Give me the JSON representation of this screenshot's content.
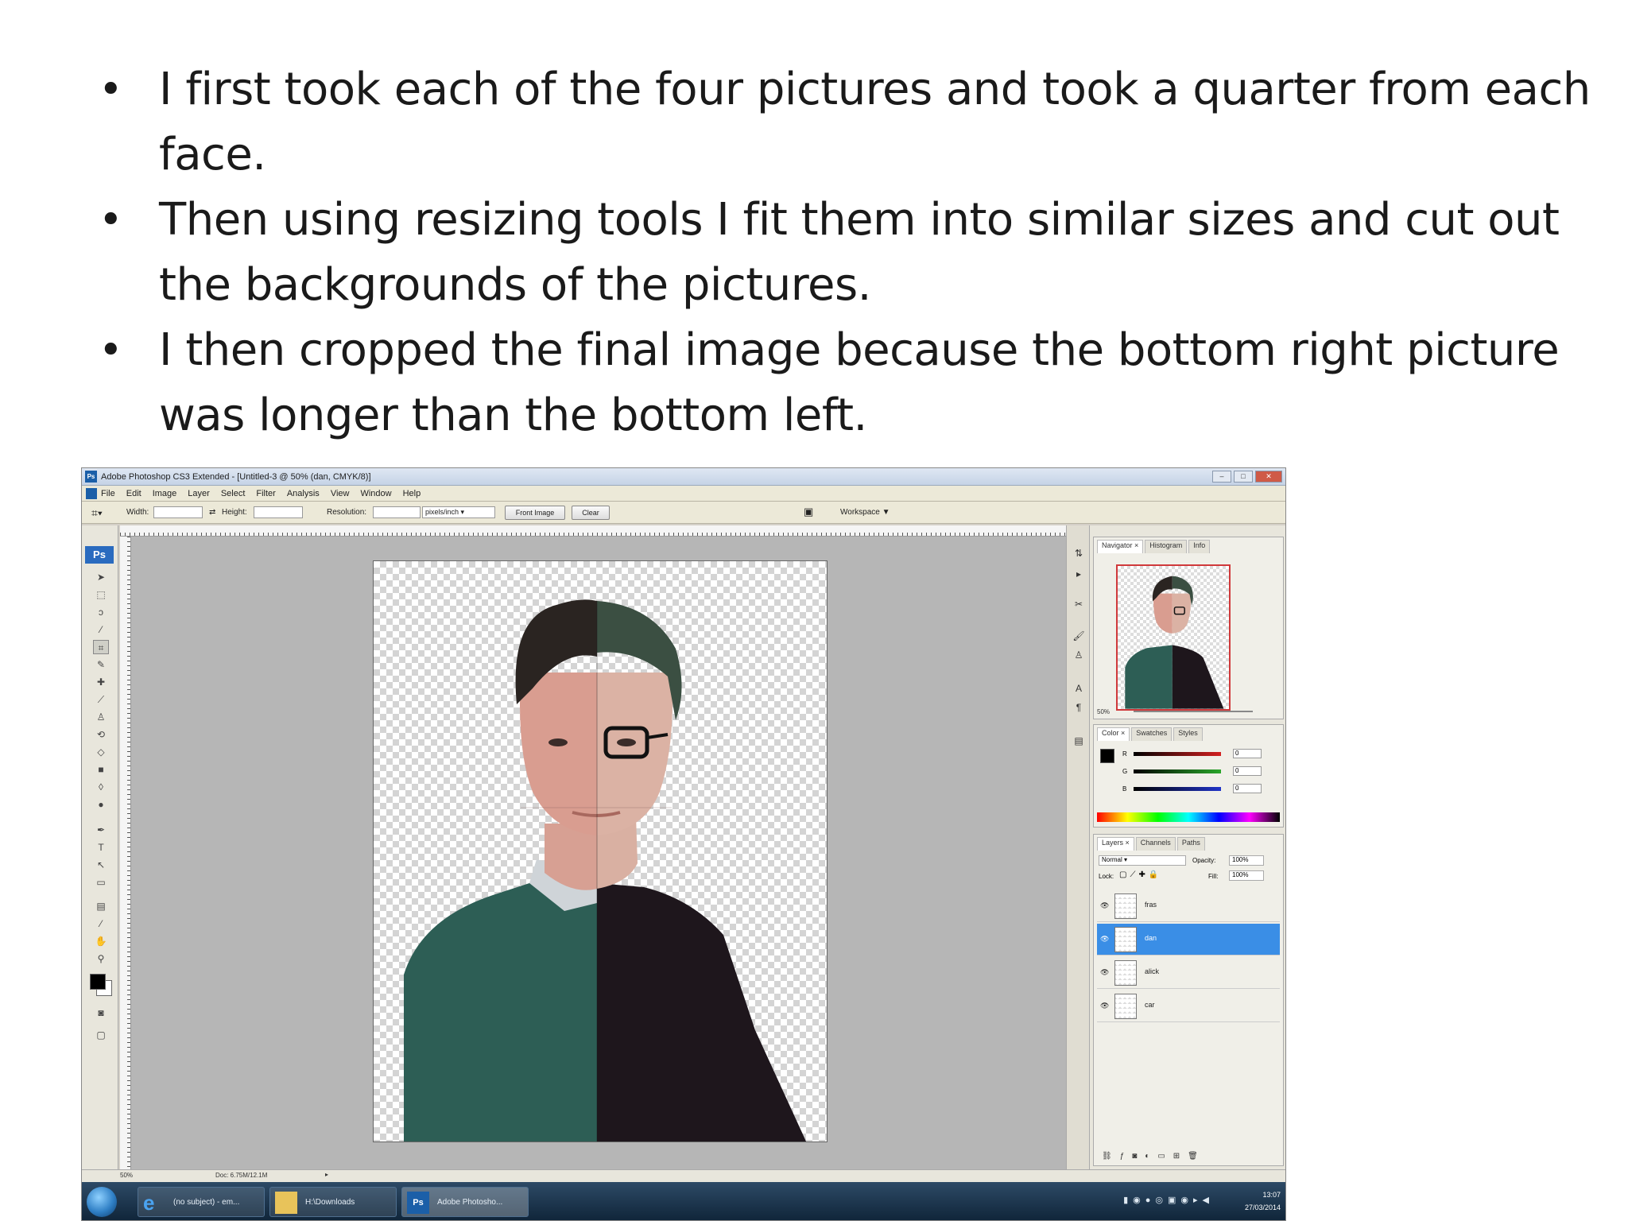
{
  "slide": {
    "bullets": [
      "I first took each of the four pictures and took a quarter from each face.",
      "Then using resizing tools I fit them into similar sizes and cut out the backgrounds of the pictures.",
      "I then cropped the final image because the bottom right picture was longer than the bottom left."
    ]
  },
  "screenshot": {
    "window_title": "Adobe Photoshop CS3 Extended - [Untitled-3 @ 50% (dan, CMYK/8)]",
    "menu": [
      "File",
      "Edit",
      "Image",
      "Layer",
      "Select",
      "Filter",
      "Analysis",
      "View",
      "Window",
      "Help"
    ],
    "options": {
      "width_label": "Width:",
      "height_label": "Height:",
      "resolution_label": "Resolution:",
      "resolution_unit": "pixels/inch",
      "front_image_button": "Front Image",
      "clear_button": "Clear",
      "workspace_label": "Workspace ▼"
    },
    "toolbox_badge": "Ps",
    "navigator": {
      "tabs": [
        "Navigator ×",
        "Histogram",
        "Info"
      ],
      "zoom": "50%"
    },
    "color_panel": {
      "tabs": [
        "Color ×",
        "Swatches",
        "Styles"
      ],
      "channels": [
        {
          "label": "R",
          "value": "0",
          "color": "#d32020"
        },
        {
          "label": "G",
          "value": "0",
          "color": "#2aa62a"
        },
        {
          "label": "B",
          "value": "0",
          "color": "#2034c8"
        }
      ]
    },
    "layers_panel": {
      "tabs": [
        "Layers ×",
        "Channels",
        "Paths"
      ],
      "blend_mode": "Normal",
      "opacity_label": "Opacity:",
      "opacity_value": "100%",
      "lock_label": "Lock:",
      "fill_label": "Fill:",
      "fill_value": "100%",
      "layers": [
        {
          "name": "fras",
          "selected": false
        },
        {
          "name": "dan",
          "selected": true
        },
        {
          "name": "alick",
          "selected": false
        },
        {
          "name": "car",
          "selected": false
        }
      ]
    },
    "status": {
      "zoom": "50%",
      "doc": "Doc: 6.75M/12.1M"
    },
    "taskbar": {
      "items": [
        "(no subject) - em...",
        "H:\\Downloads",
        "Adobe Photosho..."
      ],
      "time": "13:07",
      "date": "27/03/2014"
    },
    "colors": {
      "green_sweater": "#2d5e55",
      "dark_sweater": "#1e161c",
      "skin": "#d9a79a",
      "hair": "#2a2421",
      "selected_layer": "#3a8ee6"
    }
  }
}
